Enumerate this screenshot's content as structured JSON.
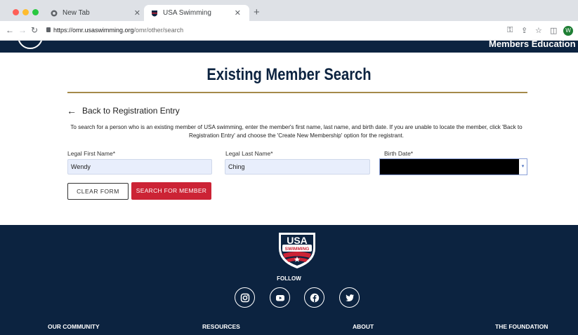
{
  "browser": {
    "tabs": [
      {
        "label": "New Tab"
      },
      {
        "label": "USA Swimming"
      }
    ],
    "url_host": "https://omr.usaswimming.org",
    "url_path": "/omr/other/search",
    "profile_initial": "W"
  },
  "header": {
    "nav_text": "Members   Education"
  },
  "page": {
    "title": "Existing Member Search",
    "back_link": "Back to Registration Entry",
    "instructions": "To search for a person who is an existing member of USA swimming, enter the member's first name, last name, and birth date. If you are unable to locate the member, click 'Back to Registration Entry' and choose the 'Create New Membership' option for the registrant.",
    "fields": {
      "first_name_label": "Legal First Name*",
      "first_name_value": "Wendy",
      "last_name_label": "Legal Last Name*",
      "last_name_value": "Ching",
      "birth_date_label": "Birth Date*"
    },
    "buttons": {
      "clear": "CLEAR FORM",
      "search": "SEARCH FOR MEMBER"
    }
  },
  "footer": {
    "logo_text_top": "USA",
    "logo_text_bottom": "SWIMMING",
    "follow_label": "FOLLOW",
    "social": [
      "instagram-icon",
      "youtube-icon",
      "facebook-icon",
      "twitter-icon"
    ],
    "columns": [
      "OUR COMMUNITY",
      "RESOURCES",
      "ABOUT",
      "THE FOUNDATION"
    ]
  },
  "colors": {
    "navy": "#0c2340",
    "gold": "#a58a4a",
    "red": "#cc2335",
    "input_bg": "#e8eefc"
  }
}
